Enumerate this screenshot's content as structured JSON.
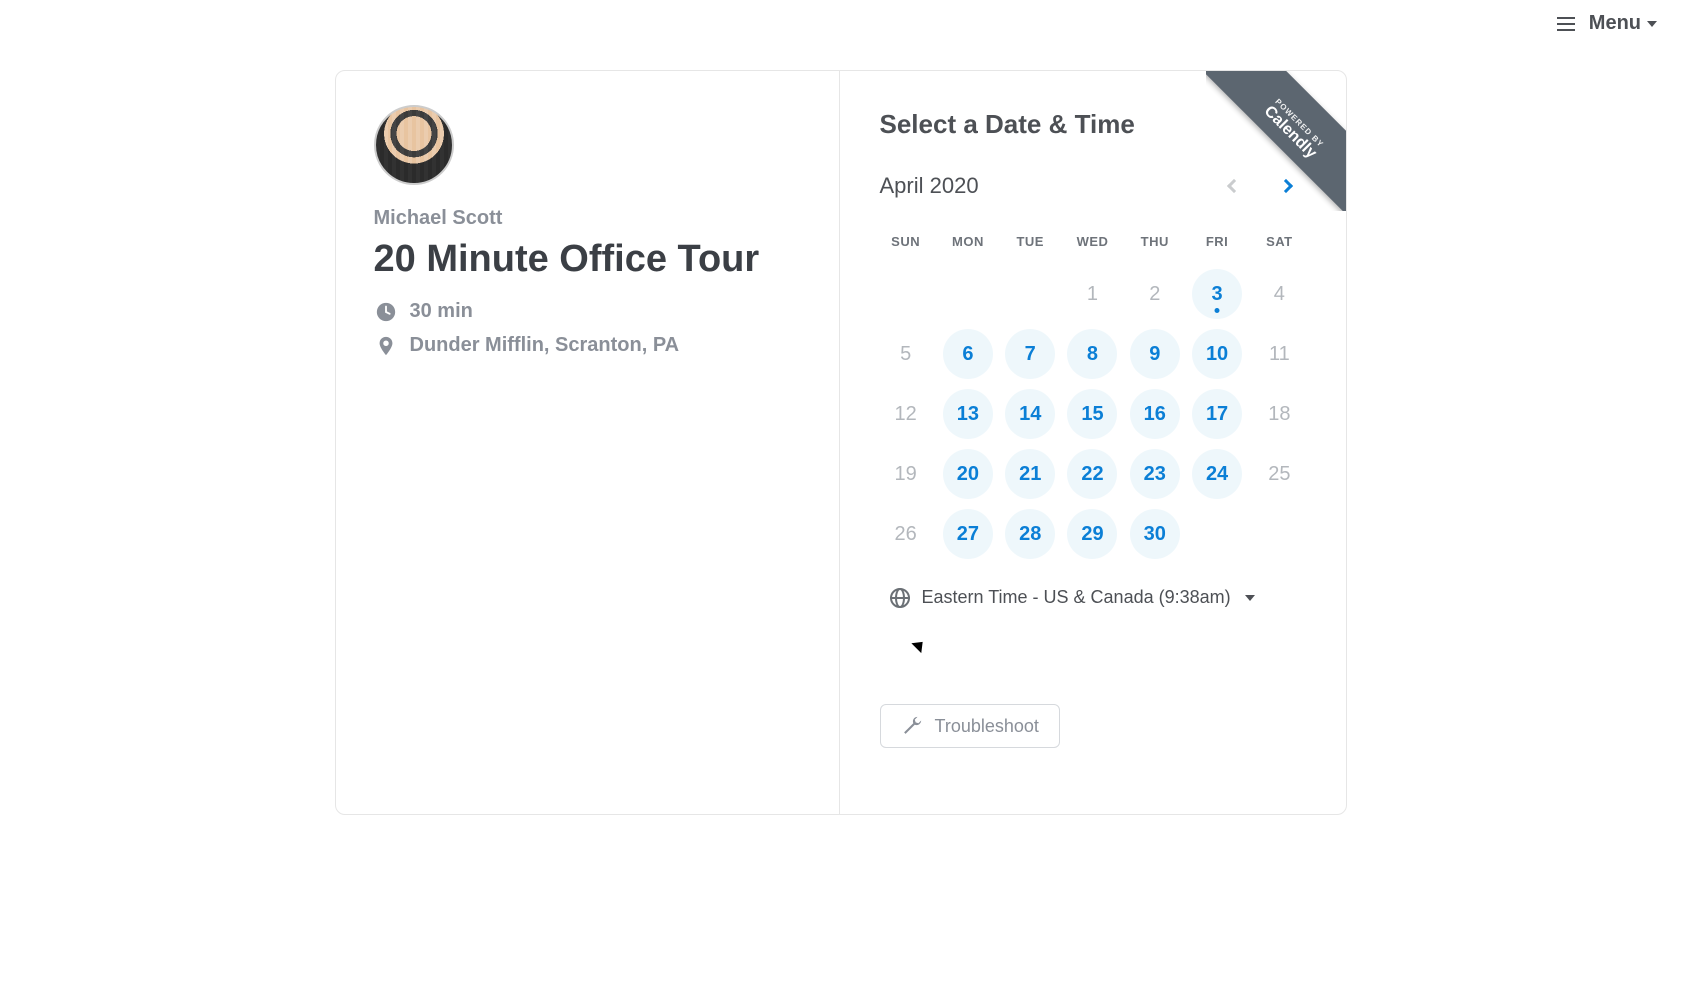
{
  "topbar": {
    "menu_label": "Menu"
  },
  "ribbon": {
    "small": "POWERED BY",
    "big": "Calendly"
  },
  "host": {
    "name": "Michael Scott"
  },
  "event": {
    "title": "20 Minute Office Tour",
    "duration": "30 min",
    "location": "Dunder Mifflin, Scranton, PA"
  },
  "picker": {
    "heading": "Select a Date & Time",
    "month_label": "April 2020",
    "days_of_week": [
      "SUN",
      "MON",
      "TUE",
      "WED",
      "THU",
      "FRI",
      "SAT"
    ],
    "cells": [
      {
        "n": "",
        "t": "empty"
      },
      {
        "n": "",
        "t": "empty"
      },
      {
        "n": "",
        "t": "empty"
      },
      {
        "n": "1",
        "t": "unavail"
      },
      {
        "n": "2",
        "t": "unavail"
      },
      {
        "n": "3",
        "t": "avail",
        "today": true
      },
      {
        "n": "4",
        "t": "unavail"
      },
      {
        "n": "5",
        "t": "unavail"
      },
      {
        "n": "6",
        "t": "avail"
      },
      {
        "n": "7",
        "t": "avail"
      },
      {
        "n": "8",
        "t": "avail"
      },
      {
        "n": "9",
        "t": "avail"
      },
      {
        "n": "10",
        "t": "avail"
      },
      {
        "n": "11",
        "t": "unavail"
      },
      {
        "n": "12",
        "t": "unavail"
      },
      {
        "n": "13",
        "t": "avail"
      },
      {
        "n": "14",
        "t": "avail"
      },
      {
        "n": "15",
        "t": "avail"
      },
      {
        "n": "16",
        "t": "avail"
      },
      {
        "n": "17",
        "t": "avail"
      },
      {
        "n": "18",
        "t": "unavail"
      },
      {
        "n": "19",
        "t": "unavail"
      },
      {
        "n": "20",
        "t": "avail"
      },
      {
        "n": "21",
        "t": "avail"
      },
      {
        "n": "22",
        "t": "avail"
      },
      {
        "n": "23",
        "t": "avail"
      },
      {
        "n": "24",
        "t": "avail"
      },
      {
        "n": "25",
        "t": "unavail"
      },
      {
        "n": "26",
        "t": "unavail"
      },
      {
        "n": "27",
        "t": "avail"
      },
      {
        "n": "28",
        "t": "avail"
      },
      {
        "n": "29",
        "t": "avail"
      },
      {
        "n": "30",
        "t": "avail"
      }
    ],
    "timezone_label": "Eastern Time - US & Canada (9:38am)",
    "troubleshoot_label": "Troubleshoot"
  }
}
